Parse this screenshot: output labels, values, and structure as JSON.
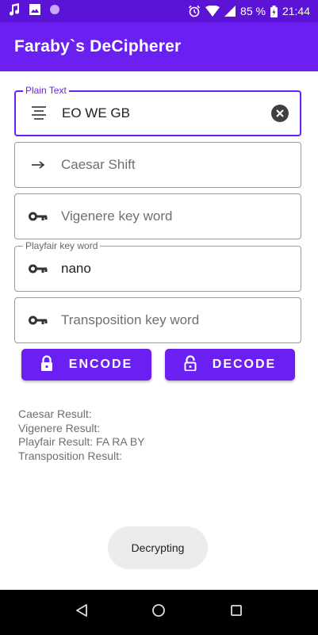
{
  "status_bar": {
    "battery": "85 %",
    "time": "21:44",
    "icons": [
      "music-note-icon",
      "image-icon",
      "circle-icon",
      "alarm-icon",
      "wifi-icon",
      "signal-icon",
      "battery-icon"
    ]
  },
  "app_bar": {
    "title": "Faraby`s DeCipherer"
  },
  "fields": {
    "plain_text": {
      "label": "Plain Text",
      "value": "EO WE GB",
      "icon": "text-lines-icon"
    },
    "caesar_shift": {
      "placeholder": "Caesar Shift",
      "icon": "arrow-right-icon"
    },
    "vigenere": {
      "placeholder": "Vigenere key word",
      "icon": "key-icon"
    },
    "playfair": {
      "label": "Playfair key word",
      "value": "nano",
      "icon": "key-icon"
    },
    "transposition": {
      "placeholder": "Transposition key word",
      "icon": "key-icon"
    }
  },
  "buttons": {
    "encode": {
      "label": "ENCODE",
      "icon": "lock-icon"
    },
    "decode": {
      "label": "DECODE",
      "icon": "unlock-icon"
    }
  },
  "results": {
    "caesar": "Caesar Result:",
    "vigenere": "Vigenere Result:",
    "playfair": "Playfair Result: FA RA BY",
    "transposition": "Transposition Result:"
  },
  "toast": {
    "text": "Decrypting"
  },
  "nav_bar": {
    "icons": [
      "back-icon",
      "home-icon",
      "recents-icon"
    ]
  },
  "colors": {
    "primary": "#6b1ff0",
    "primary_dark": "#5b14d6"
  }
}
